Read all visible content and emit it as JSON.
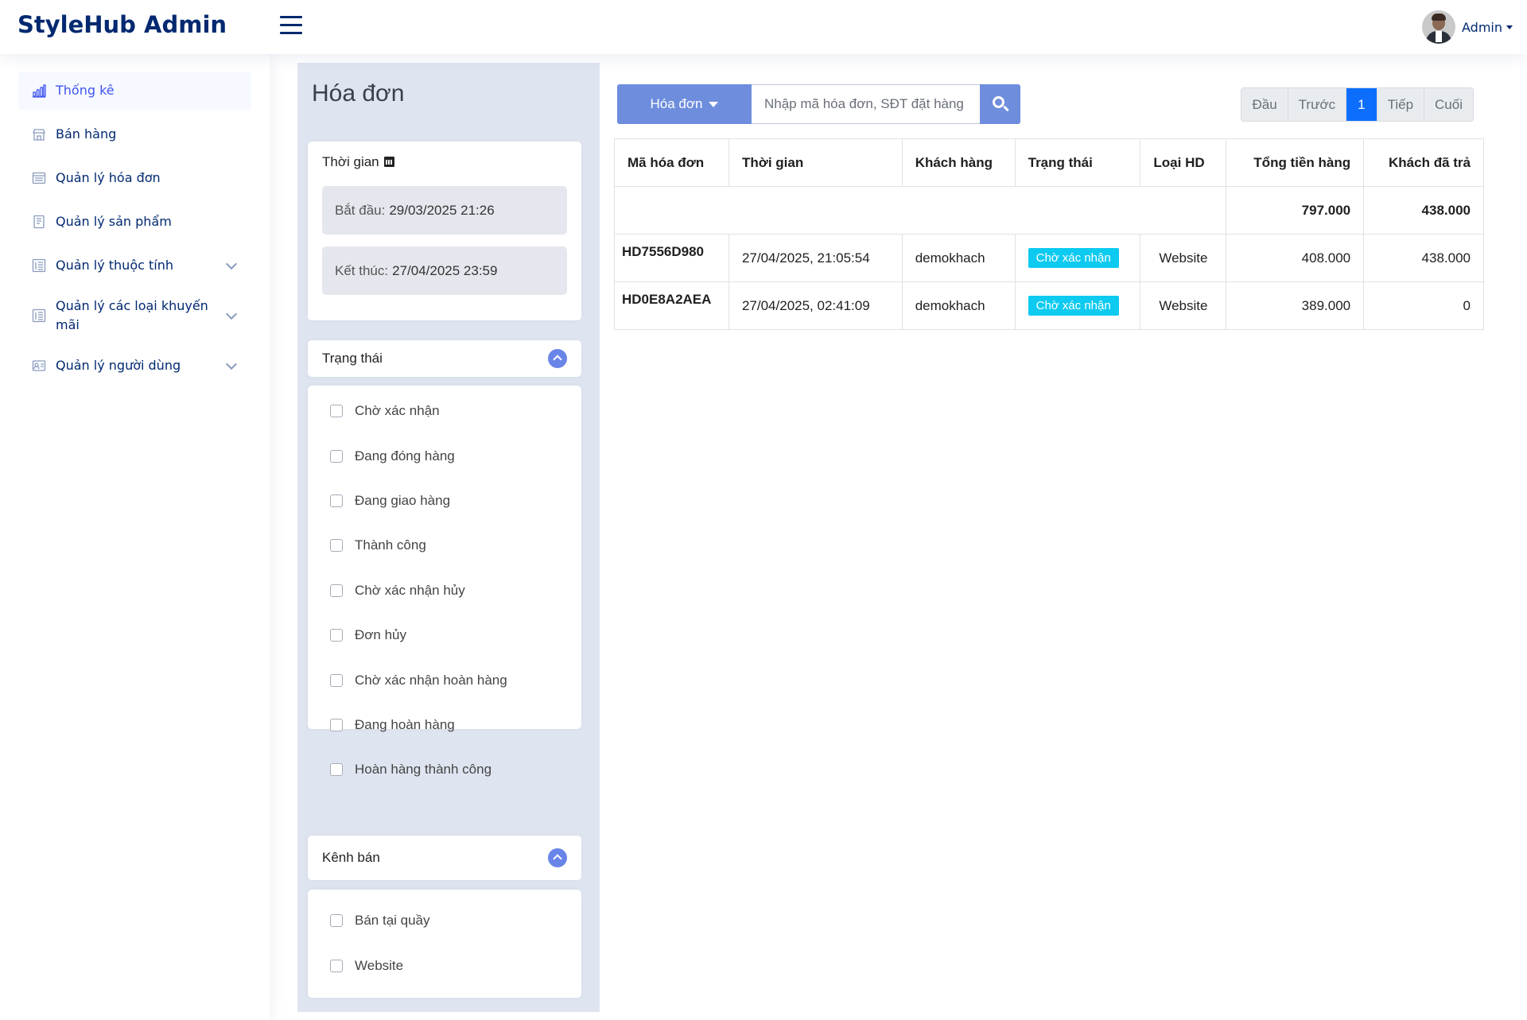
{
  "header": {
    "brand": "StyleHub Admin",
    "user_name": "Admin"
  },
  "sidebar": {
    "items": [
      {
        "label": "Thống kê",
        "icon": "bar-chart-icon",
        "active": true
      },
      {
        "label": "Bán hàng",
        "icon": "shop-icon"
      },
      {
        "label": "Quản lý hóa đơn",
        "icon": "receipt-icon"
      },
      {
        "label": "Quản lý sản phẩm",
        "icon": "document-icon"
      },
      {
        "label": "Quản lý thuộc tính",
        "icon": "list-icon",
        "expandable": true
      },
      {
        "label": "Quản lý các loại khuyến mãi",
        "icon": "list-icon",
        "expandable": true
      },
      {
        "label": "Quản lý người dùng",
        "icon": "person-card-icon",
        "expandable": true
      }
    ]
  },
  "filters": {
    "page_title": "Hóa đơn",
    "time": {
      "title": "Thời gian",
      "start_label": "Bắt đầu:",
      "start_value": "29/03/2025 21:26",
      "end_label": "Kết thúc:",
      "end_value": "27/04/2025 23:59"
    },
    "status": {
      "title": "Trạng thái",
      "options": [
        "Chờ xác nhận",
        "Đang đóng hàng",
        "Đang giao hàng",
        "Thành công",
        "Chờ xác nhận hủy",
        "Đơn hủy",
        "Chờ xác nhận hoàn hàng",
        "Đang hoàn hàng",
        "Hoàn hàng thành công"
      ]
    },
    "channel": {
      "title": "Kênh bán",
      "options": [
        "Bán tại quầy",
        "Website"
      ]
    }
  },
  "toolbar": {
    "filter_label": "Hóa đơn",
    "search_placeholder": "Nhập mã hóa đơn, SĐT đặt hàng",
    "pager": {
      "first": "Đầu",
      "prev": "Trước",
      "current": "1",
      "next": "Tiếp",
      "last": "Cuối"
    }
  },
  "table": {
    "columns": [
      "Mã hóa đơn",
      "Thời gian",
      "Khách hàng",
      "Trạng thái",
      "Loại HD",
      "Tổng tiền hàng",
      "Khách đã trả"
    ],
    "totals": {
      "total": "797.000",
      "paid": "438.000"
    },
    "rows": [
      {
        "code": "HD7556D980",
        "time": "27/04/2025, 21:05:54",
        "customer": "demokhach",
        "status": "Chờ xác nhận",
        "type": "Website",
        "total": "408.000",
        "paid": "438.000"
      },
      {
        "code": "HD0E8A2AEA",
        "time": "27/04/2025, 02:41:09",
        "customer": "demokhach",
        "status": "Chờ xác nhận",
        "type": "Website",
        "total": "389.000",
        "paid": "0"
      }
    ]
  },
  "colors": {
    "accent": "#6e8ddd",
    "brand": "#012970",
    "badge": "#0dcaf0",
    "pager_active": "#0d6efd"
  }
}
